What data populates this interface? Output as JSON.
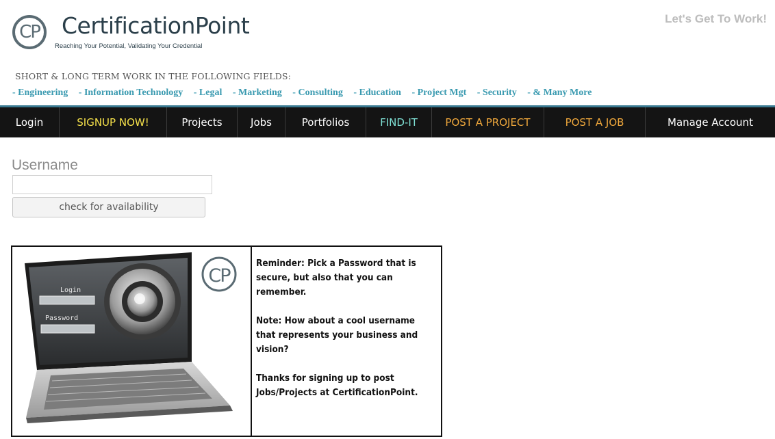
{
  "brand": {
    "logo_initials": "CP",
    "name": "CertificationPoint",
    "tagline": "Reaching Your Potential, Validating Your Credential",
    "slogan": "Let's Get To Work!"
  },
  "fields": {
    "heading": "SHORT & LONG TERM WORK IN THE FOLLOWING FIELDS:",
    "items": [
      "- Engineering",
      "- Information Technology",
      "- Legal",
      "- Marketing",
      "- Consulting",
      "- Education",
      "- Project Mgt",
      "- Security",
      "- & Many More"
    ]
  },
  "nav": {
    "items": [
      {
        "label": "Login",
        "color": "#ffffff"
      },
      {
        "label": "SIGNUP NOW!",
        "color": "#f5e14a"
      },
      {
        "label": "Projects",
        "color": "#ffffff"
      },
      {
        "label": "Jobs",
        "color": "#ffffff"
      },
      {
        "label": "Portfolios",
        "color": "#ffffff"
      },
      {
        "label": "FIND-IT",
        "color": "#7fe0d4"
      },
      {
        "label": "POST A PROJECT",
        "color": "#f0a83c"
      },
      {
        "label": "POST A JOB",
        "color": "#f0a83c"
      },
      {
        "label": "Manage Account",
        "color": "#ffffff"
      }
    ]
  },
  "form": {
    "username_label": "Username",
    "username_value": "",
    "check_button": "check for availability"
  },
  "info": {
    "image": {
      "login_label": "Login",
      "password_label": "Password",
      "logo_initials": "CP"
    },
    "paragraphs": [
      "Reminder: Pick a Password that is secure, but also that you can remember.",
      "Note: How about a cool username that represents your business and vision?",
      "Thanks for signing up to post Jobs/Projects at CertificationPoint."
    ]
  },
  "colors": {
    "accent": "#3a9ab0",
    "nav_bg": "#141414",
    "brand_dark": "#2b3f4a"
  }
}
